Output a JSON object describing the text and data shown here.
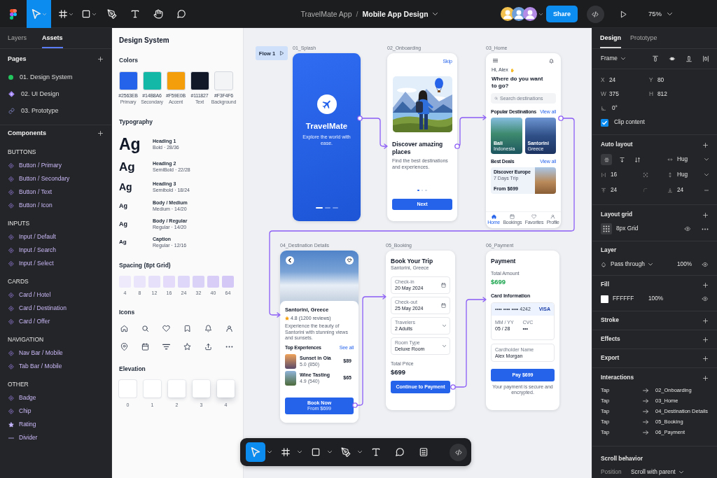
{
  "topbar": {
    "tools": [
      {
        "kind": "move",
        "selected": true,
        "dropdown": true
      },
      {
        "kind": "frame",
        "selected": false,
        "dropdown": true
      },
      {
        "kind": "rect",
        "selected": false,
        "dropdown": true
      },
      {
        "kind": "pen",
        "selected": false,
        "dropdown": false
      },
      {
        "kind": "text",
        "selected": false,
        "dropdown": false
      },
      {
        "kind": "hand",
        "selected": false,
        "dropdown": false
      },
      {
        "kind": "comment",
        "selected": false,
        "dropdown": false
      }
    ],
    "project": "TravelMate App",
    "separator": "/",
    "file": "Mobile App Design",
    "avatars": [
      {
        "color": "#f2c14e"
      },
      {
        "color": "#6f9fd8"
      },
      {
        "color": "#b48be6"
      }
    ],
    "share": "Share",
    "zoom": "75%"
  },
  "left_panel": {
    "tabs": [
      {
        "label": "Layers",
        "selected": false
      },
      {
        "label": "Assets",
        "selected": true
      }
    ],
    "pages_title": "Pages",
    "pages": [
      {
        "kind": "current",
        "label": "01. Design System"
      },
      {
        "kind": "component",
        "label": "02. UI Design"
      },
      {
        "kind": "link",
        "label": "03. Prototype"
      }
    ],
    "components_title": "Components",
    "groups": [
      {
        "title": "BUTTONS",
        "items": [
          {
            "kind": "component",
            "label": "Button / Primary"
          },
          {
            "kind": "component",
            "label": "Button / Secondary"
          },
          {
            "kind": "component",
            "label": "Button / Text"
          },
          {
            "kind": "component",
            "label": "Button / Icon"
          }
        ]
      },
      {
        "title": "INPUTS",
        "items": [
          {
            "kind": "component",
            "label": "Input / Default"
          },
          {
            "kind": "component",
            "label": "Input / Search"
          },
          {
            "kind": "component",
            "label": "Input / Select"
          }
        ]
      },
      {
        "title": "CARDS",
        "items": [
          {
            "kind": "component",
            "label": "Card / Hotel"
          },
          {
            "kind": "component",
            "label": "Card / Destination"
          },
          {
            "kind": "component",
            "label": "Card / Offer"
          }
        ]
      },
      {
        "title": "NAVIGATION",
        "items": [
          {
            "kind": "component",
            "label": "Nav Bar / Mobile"
          },
          {
            "kind": "component",
            "label": "Tab Bar / Mobile"
          }
        ]
      },
      {
        "title": "OTHER",
        "items": [
          {
            "kind": "component",
            "label": "Badge"
          },
          {
            "kind": "component",
            "label": "Chip"
          },
          {
            "kind": "star",
            "label": "Rating"
          },
          {
            "kind": "divider",
            "label": "Divider"
          }
        ]
      }
    ]
  },
  "design_system": {
    "title": "Design System",
    "colors_title": "Colors",
    "colors": [
      {
        "color": "#2563eb",
        "hex": "#2563EB",
        "name": "Primary"
      },
      {
        "color": "#14b8a6",
        "hex": "#14B8A6",
        "name": "Secondary"
      },
      {
        "color": "#f59e0b",
        "hex": "#F59E0B",
        "name": "Accent"
      },
      {
        "color": "#111827",
        "hex": "#111827",
        "name": "Text"
      },
      {
        "color": "#f3f4f6",
        "hex": "#F3F4F6",
        "name": "Background"
      }
    ],
    "typography_title": "Typography",
    "type_styles": [
      {
        "kind": "h1",
        "sample": "Ag",
        "name": "Heading 1",
        "spec": "Bold · 28/36"
      },
      {
        "kind": "h2",
        "sample": "Ag",
        "name": "Heading 2",
        "spec": "SemiBold · 22/28"
      },
      {
        "kind": "h3",
        "sample": "Ag",
        "name": "Heading 3",
        "spec": "Semibold · 18/24"
      },
      {
        "kind": "body",
        "sample": "Ag",
        "name": "Body / Medium",
        "spec": "Medium · 14/20"
      },
      {
        "kind": "body",
        "sample": "Ag",
        "name": "Body / Regular",
        "spec": "Regular · 14/20"
      },
      {
        "kind": "caption",
        "sample": "Ag",
        "name": "Caption",
        "spec": "Regular · 12/16"
      }
    ],
    "spacing_title": "Spacing (8pt Grid)",
    "spacing": [
      "4",
      "8",
      "12",
      "16",
      "24",
      "32",
      "40",
      "64"
    ],
    "icons_title": "Icons",
    "elevation_title": "Elevation",
    "elevation": [
      "0",
      "1",
      "2",
      "3",
      "4"
    ]
  },
  "canvas": {
    "flow": "Flow 1",
    "frames": [
      {
        "kind": "splash",
        "label": "01_Splash",
        "brand": "TravelMate",
        "tagline": "Explore the world with ease.",
        "pages": [
          {
            "selected": true
          },
          {
            "selected": false
          },
          {
            "selected": false
          }
        ]
      },
      {
        "kind": "onboarding",
        "label": "02_Onboarding",
        "skip": "Skip",
        "title": "Discover amazing places",
        "text": "Find the best destinations and experiences.",
        "dots": [
          {
            "selected": true
          },
          {
            "selected": false
          },
          {
            "selected": false
          }
        ],
        "button": "Next"
      },
      {
        "kind": "home",
        "label": "03_Home",
        "greeting": "Hi, Alex",
        "heading": "Where do you want to go?",
        "search_placeholder": "Search destinations",
        "popular_title": "Popular Destinations",
        "popular_link": "View all",
        "destinations": [
          {
            "name": "Bali",
            "country": "Indonesia"
          },
          {
            "name": "Santorini",
            "country": "Greece"
          }
        ],
        "deals_title": "Best Deals",
        "deals_link": "View all",
        "deal": {
          "title": "Discover Europe",
          "duration": "7 Days Trip",
          "price": "From $699"
        },
        "tabs": [
          {
            "kind": "home",
            "label": "Home",
            "selected": true
          },
          {
            "kind": "bookings",
            "label": "Bookings",
            "selected": false
          },
          {
            "kind": "favorites",
            "label": "Favorites",
            "selected": false
          },
          {
            "kind": "profile",
            "label": "Profile",
            "selected": false
          }
        ]
      },
      {
        "kind": "details",
        "label": "04_Destination Details",
        "title": "Santorini, Greece",
        "rating": "4.8 (1200 reviews)",
        "description": "Experience the beauty of Santorini with stunning views and sunsets.",
        "section": "Top Experiences",
        "link": "See all",
        "experiences": [
          {
            "name": "Sunset in Oia",
            "rating": "5.0 (850)",
            "price": "$89"
          },
          {
            "name": "Wine Tasting",
            "rating": "4.9 (540)",
            "price": "$65"
          }
        ],
        "button": "Book Now",
        "button_note": "From $699"
      },
      {
        "kind": "booking",
        "label": "05_Booking",
        "title": "Book Your Trip",
        "subtitle": "Santorini, Greece",
        "fields": [
          {
            "kind": "date",
            "label": "Check-in",
            "value": "20 May 2024"
          },
          {
            "kind": "date",
            "label": "Check-out",
            "value": "25 May 2024"
          },
          {
            "kind": "select",
            "label": "Travelers",
            "value": "2 Adults"
          },
          {
            "kind": "select",
            "label": "Room Type",
            "value": "Deluxe Room"
          }
        ],
        "total_label": "Total Price",
        "total": "$699",
        "button": "Continue to Payment"
      },
      {
        "kind": "payment",
        "label": "06_Payment",
        "title": "Payment",
        "total_label": "Total Amount",
        "total": "$699",
        "section": "Card Information",
        "card_number": "•••• •••• •••• 4242",
        "card_brand": "VISA",
        "expiry_label": "MM / YY",
        "expiry": "05 / 28",
        "cvc_label": "CVC",
        "cvc": "•••",
        "name_label": "Cardholder Name",
        "name": "Alex Morgan",
        "button": "Pay $699",
        "note": "Your payment is secure and encrypted."
      }
    ]
  },
  "canvas_toolbar": {
    "tools": [
      {
        "kind": "move",
        "selected": true,
        "dropdown": true
      },
      {
        "kind": "frame",
        "selected": false,
        "dropdown": true
      },
      {
        "kind": "rect",
        "selected": false,
        "dropdown": true
      },
      {
        "kind": "pen",
        "selected": false,
        "dropdown": true
      },
      {
        "kind": "text",
        "selected": false,
        "dropdown": false
      },
      {
        "kind": "comment",
        "selected": false,
        "dropdown": false
      },
      {
        "kind": "apps",
        "selected": false,
        "dropdown": false
      }
    ]
  },
  "right_panel": {
    "tabs": [
      {
        "label": "Design",
        "selected": true
      },
      {
        "label": "Prototype",
        "selected": false
      }
    ],
    "frame": "Frame",
    "position": [
      {
        "axis": "X",
        "value": "24"
      },
      {
        "axis": "Y",
        "value": "80"
      },
      {
        "axis": "W",
        "value": "375"
      },
      {
        "axis": "H",
        "value": "812"
      }
    ],
    "rotation": "0°",
    "clip": {
      "label": "Clip content",
      "checked": true
    },
    "auto_layout": {
      "title": "Auto layout",
      "directions": [
        {
          "kind": "vertical",
          "selected": true
        },
        {
          "kind": "down",
          "selected": false
        },
        {
          "kind": "wrap",
          "selected": false
        }
      ],
      "width": "Hug",
      "gap": "16",
      "height": "Hug",
      "paddings": [
        "24",
        "24"
      ]
    },
    "layout_grid": {
      "title": "Layout grid",
      "name": "8px Grid"
    },
    "layer": {
      "title": "Layer",
      "blend": "Pass through",
      "opacity": "100%"
    },
    "fill": {
      "title": "Fill",
      "hex": "FFFFFF",
      "opacity": "100%"
    },
    "sections": [
      "Stroke",
      "Effects",
      "Export"
    ],
    "interactions": {
      "title": "Interactions",
      "items": [
        {
          "trigger": "Tap",
          "target": "02_Onboarding"
        },
        {
          "trigger": "Tap",
          "target": "03_Home"
        },
        {
          "trigger": "Tap",
          "target": "04_Destination Details"
        },
        {
          "trigger": "Tap",
          "target": "05_Booking"
        },
        {
          "trigger": "Tap",
          "target": "06_Payment"
        }
      ]
    },
    "scroll": {
      "title": "Scroll behavior",
      "label": "Position",
      "value": "Scroll with parent"
    }
  }
}
